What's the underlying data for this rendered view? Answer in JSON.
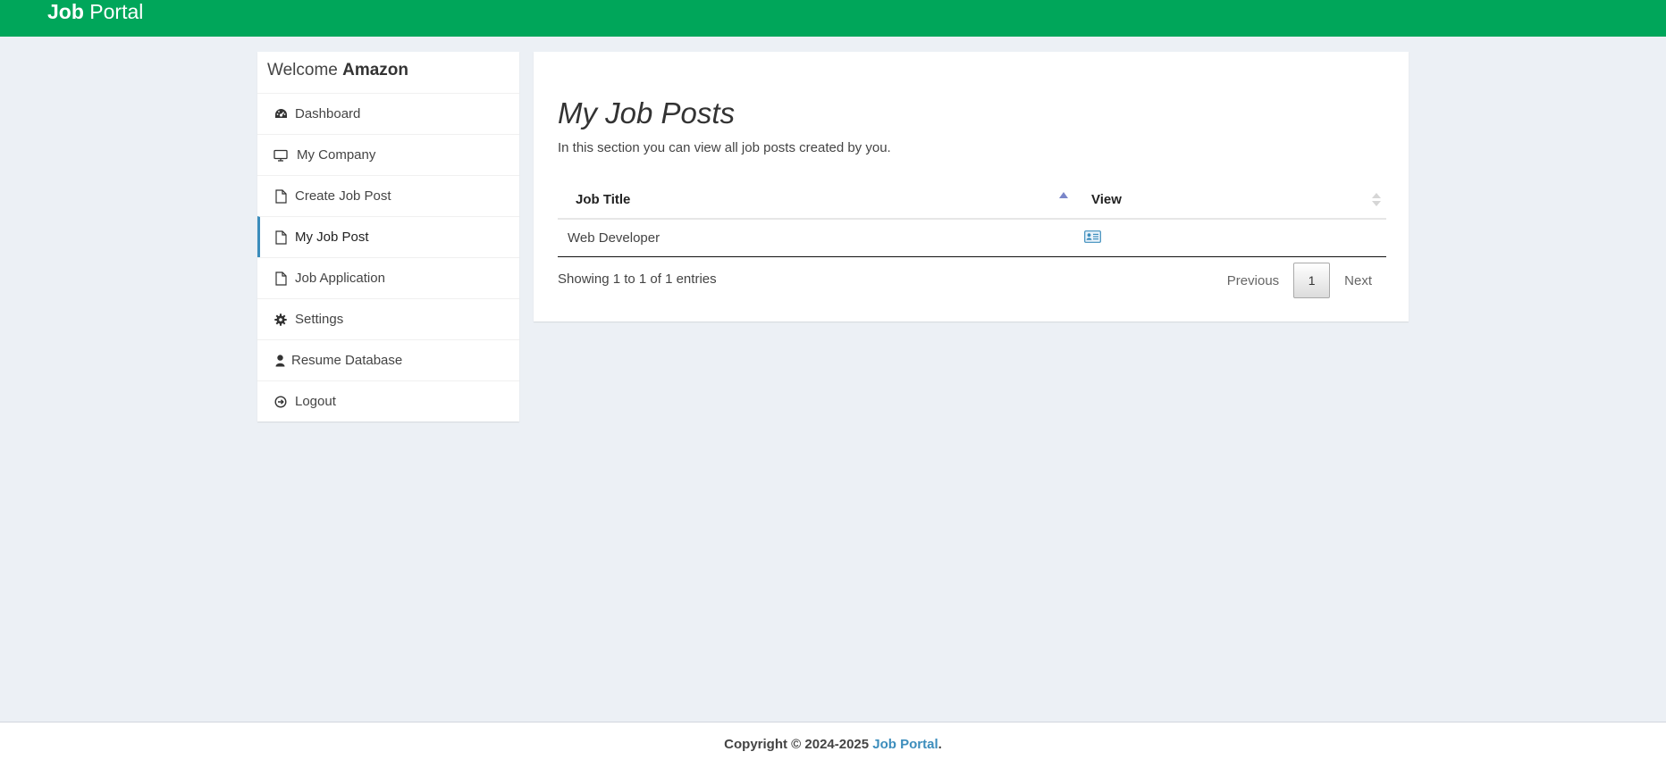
{
  "header": {
    "brand_bold": "Job",
    "brand_rest": "Portal",
    "bg_color": "#00a65a"
  },
  "sidebar": {
    "welcome_prefix": "Welcome",
    "welcome_name": "Amazon",
    "items": [
      {
        "label": "Dashboard",
        "icon": "dashboard-icon"
      },
      {
        "label": "My Company",
        "icon": "monitor-icon"
      },
      {
        "label": "Create Job Post",
        "icon": "file-icon"
      },
      {
        "label": "My Job Post",
        "icon": "file-icon",
        "active": true
      },
      {
        "label": "Job Application",
        "icon": "file-icon"
      },
      {
        "label": "Settings",
        "icon": "gear-icon"
      },
      {
        "label": "Resume Database",
        "icon": "user-icon"
      },
      {
        "label": "Logout",
        "icon": "logout-icon"
      }
    ],
    "active_color": "#3c8dbc"
  },
  "main": {
    "title": "My Job Posts",
    "subtitle": "In this section you can view all job posts created by you.",
    "table": {
      "columns": [
        "Job Title",
        "View"
      ],
      "rows": [
        {
          "job_title": "Web Developer",
          "view_icon": "id-card-icon"
        }
      ]
    },
    "info": "Showing 1 to 1 of 1 entries",
    "pagination": {
      "previous": "Previous",
      "current_page": "1",
      "next": "Next"
    }
  },
  "footer": {
    "prefix": "Copyright © 2024-2025",
    "link_text": "Job Portal",
    "suffix": "."
  }
}
